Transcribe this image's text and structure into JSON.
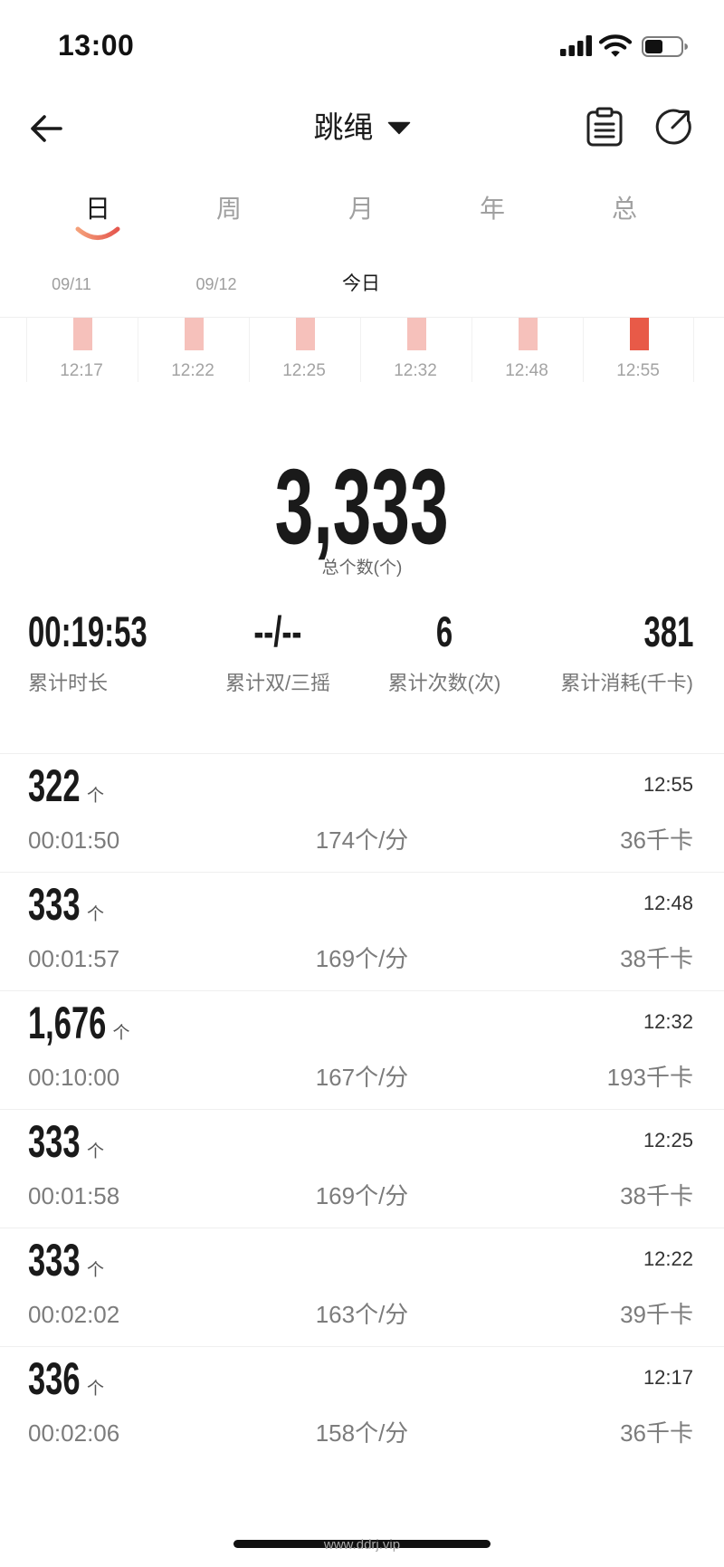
{
  "status_bar": {
    "time": "13:00",
    "battery_level": 0.5,
    "icons": [
      "cellular-signal-icon",
      "wifi-icon",
      "battery-icon"
    ]
  },
  "header": {
    "title": "跳绳",
    "icons": {
      "back": "back-arrow-icon",
      "dropdown": "caret-down-icon",
      "records": "clipboard-icon",
      "share": "share-icon"
    }
  },
  "period_tabs": [
    {
      "label": "日",
      "active": true
    },
    {
      "label": "周",
      "active": false
    },
    {
      "label": "月",
      "active": false
    },
    {
      "label": "年",
      "active": false
    },
    {
      "label": "总",
      "active": false
    }
  ],
  "date_tabs": [
    {
      "label": "09/11",
      "active": false
    },
    {
      "label": "09/12",
      "active": false
    },
    {
      "label": "今日",
      "active": true
    }
  ],
  "session_strip": {
    "sessions": [
      {
        "time": "12:17",
        "highlighted": false
      },
      {
        "time": "12:22",
        "highlighted": false
      },
      {
        "time": "12:25",
        "highlighted": false
      },
      {
        "time": "12:32",
        "highlighted": false
      },
      {
        "time": "12:48",
        "highlighted": false
      },
      {
        "time": "12:55",
        "highlighted": true
      }
    ]
  },
  "summary": {
    "total_count": "3,333",
    "total_label": "总个数(个)"
  },
  "stats": [
    {
      "value": "00:19:53",
      "label": "累计时长"
    },
    {
      "value": "--/--",
      "label": "累计双/三摇"
    },
    {
      "value": "6",
      "label": "累计次数(次)"
    },
    {
      "value": "381",
      "label": "累计消耗(千卡)"
    }
  ],
  "records": [
    {
      "count": "322",
      "unit": "个",
      "time": "12:55",
      "duration": "00:01:50",
      "rate": "174个/分",
      "calories": "36千卡"
    },
    {
      "count": "333",
      "unit": "个",
      "time": "12:48",
      "duration": "00:01:57",
      "rate": "169个/分",
      "calories": "38千卡"
    },
    {
      "count": "1,676",
      "unit": "个",
      "time": "12:32",
      "duration": "00:10:00",
      "rate": "167个/分",
      "calories": "193千卡"
    },
    {
      "count": "333",
      "unit": "个",
      "time": "12:25",
      "duration": "00:01:58",
      "rate": "169个/分",
      "calories": "38千卡"
    },
    {
      "count": "333",
      "unit": "个",
      "time": "12:22",
      "duration": "00:02:02",
      "rate": "163个/分",
      "calories": "39千卡"
    },
    {
      "count": "336",
      "unit": "个",
      "time": "12:17",
      "duration": "00:02:06",
      "rate": "158个/分",
      "calories": "36千卡"
    }
  ],
  "watermark": "www.ddrj.vip",
  "colors": {
    "accent": "#e85a48",
    "bar_light": "#f6c1bb",
    "text_primary": "#1a1a1a",
    "text_secondary": "#7c7c7c",
    "divider": "#efefef"
  }
}
